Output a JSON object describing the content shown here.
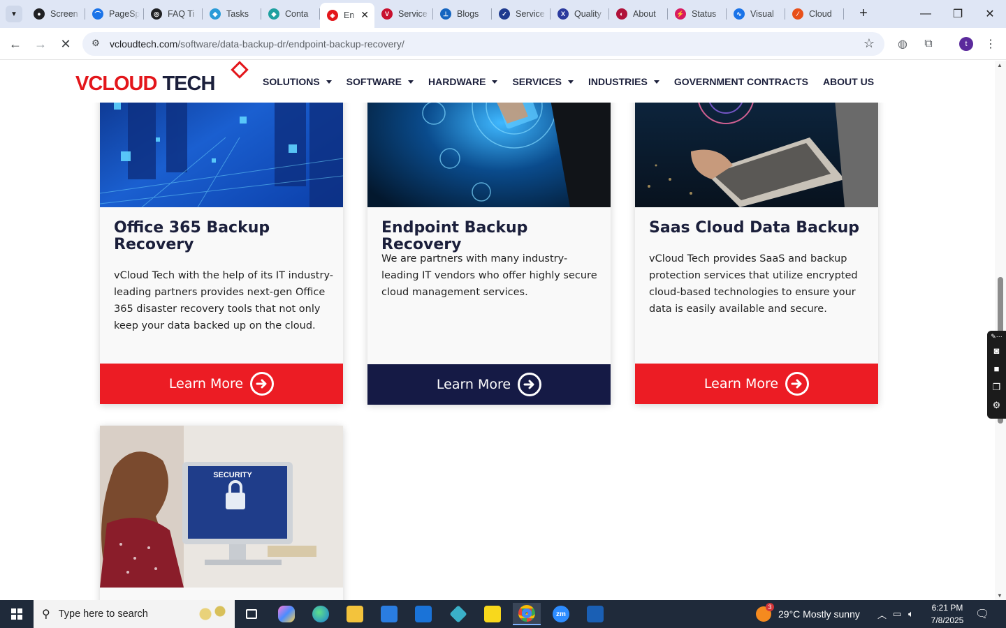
{
  "browser": {
    "tabs": [
      {
        "title": "Screen",
        "fav_color": "#202124",
        "fav_glyph": "●"
      },
      {
        "title": "PageSp",
        "fav_color": "#1a73e8",
        "fav_glyph": "⌒"
      },
      {
        "title": "FAQ Ti",
        "fav_color": "#202124",
        "fav_glyph": "◎"
      },
      {
        "title": "Tasks",
        "fav_color": "#2a9bd8",
        "fav_glyph": "◆"
      },
      {
        "title": "Conta",
        "fav_color": "#1ea0a0",
        "fav_glyph": "◆"
      },
      {
        "title": "En",
        "fav_color": "#e3161b",
        "fav_glyph": "◈",
        "active": true
      },
      {
        "title": "Service",
        "fav_color": "#c8102e",
        "fav_glyph": "V"
      },
      {
        "title": "Blogs",
        "fav_color": "#1565c0",
        "fav_glyph": "⊥"
      },
      {
        "title": "Service",
        "fav_color": "#1f3b8f",
        "fav_glyph": "✓"
      },
      {
        "title": "Quality",
        "fav_color": "#2b3a9e",
        "fav_glyph": "X"
      },
      {
        "title": "About",
        "fav_color": "#b0123a",
        "fav_glyph": "◐"
      },
      {
        "title": "Status",
        "fav_color": "#d81b60",
        "fav_glyph": "⚡"
      },
      {
        "title": "Visual",
        "fav_color": "#1a73e8",
        "fav_glyph": "∿"
      },
      {
        "title": "Cloud",
        "fav_color": "#e8501a",
        "fav_glyph": "⁄"
      }
    ],
    "new_tab": "+",
    "url_host": "vcloudtech.com",
    "url_path": "/software/data-backup-dr/endpoint-backup-recovery/",
    "profile_initial": "t"
  },
  "site": {
    "logo": {
      "v": "V",
      "cloud": "CLOUD",
      "tech": "TECH"
    },
    "nav": [
      {
        "label": "SOLUTIONS",
        "dropdown": true
      },
      {
        "label": "SOFTWARE",
        "dropdown": true
      },
      {
        "label": "HARDWARE",
        "dropdown": true
      },
      {
        "label": "SERVICES",
        "dropdown": true
      },
      {
        "label": "INDUSTRIES",
        "dropdown": true
      },
      {
        "label": "GOVERNMENT CONTRACTS",
        "dropdown": false
      },
      {
        "label": "ABOUT US",
        "dropdown": false
      }
    ]
  },
  "cards": [
    {
      "title": "Office 365 Backup Recovery",
      "body": "vCloud Tech with the help of its IT industry-leading partners provides next-gen Office 365 disaster recovery tools that not only keep your data backed up on the cloud.",
      "button": "Learn More",
      "button_color": "#ec1c24"
    },
    {
      "title": "Endpoint Backup Recovery",
      "body": "We are partners with many industry-leading IT vendors who offer highly secure cloud management services.",
      "button": "Learn More",
      "button_color": "#151a45"
    },
    {
      "title": "Saas Cloud Data Backup",
      "body": "vCloud Tech provides SaaS and backup protection services that utilize encrypted cloud-based technologies to ensure your data is easily available and secure.",
      "button": "Learn More",
      "button_color": "#ec1c24"
    }
  ],
  "card4": {
    "image_text": "SECURITY"
  },
  "taskbar": {
    "search_placeholder": "Type here to search",
    "weather": "29°C  Mostly sunny",
    "weather_badge": "3",
    "time": "6:21 PM",
    "date": "7/8/2025"
  },
  "colors": {
    "brand_red": "#e3161b",
    "brand_navy": "#1b1f3b"
  }
}
